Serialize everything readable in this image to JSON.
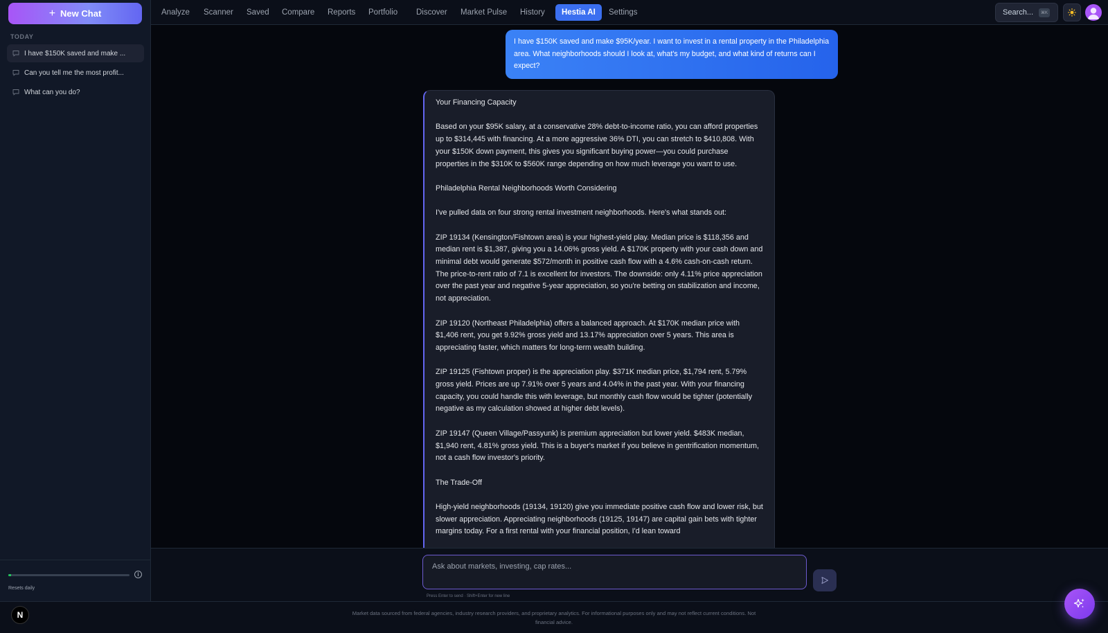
{
  "sidebar": {
    "new_chat_label": "New Chat",
    "section_label": "TODAY",
    "conversations": [
      {
        "title": "I have $150K saved and make ..."
      },
      {
        "title": "Can you tell me the most profit..."
      },
      {
        "title": "What can you do?"
      }
    ],
    "usage_fraction": 0.02,
    "resets_label": "Resets daily"
  },
  "nav": {
    "tabs": [
      "Analyze",
      "Scanner",
      "Saved",
      "Compare",
      "Reports",
      "Portfolio",
      "Discover",
      "Market Pulse",
      "History",
      "Hestia AI",
      "Settings"
    ],
    "active_tab": "Hestia AI",
    "search_label": "Search...",
    "search_shortcut": "⌘K"
  },
  "chat": {
    "user_message": "I have $150K saved and make $95K/year. I want to invest in a rental property in the Philadelphia area. What neighborhoods should I look at, what's my budget, and what kind of returns can I expect?",
    "assistant_paragraphs": [
      "Your Financing Capacity",
      "Based on your $95K salary, at a conservative 28% debt-to-income ratio, you can afford properties up to $314,445 with financing. At a more aggressive 36% DTI, you can stretch to $410,808. With your $150K down payment, this gives you significant buying power—you could purchase properties in the $310K to $560K range depending on how much leverage you want to use.",
      "Philadelphia Rental Neighborhoods Worth Considering",
      "I've pulled data on four strong rental investment neighborhoods. Here's what stands out:",
      "ZIP 19134 (Kensington/Fishtown area) is your highest-yield play. Median price is $118,356 and median rent is $1,387, giving you a 14.06% gross yield. A $170K property with your cash down and minimal debt would generate $572/month in positive cash flow with a 4.6% cash-on-cash return. The price-to-rent ratio of 7.1 is excellent for investors. The downside: only 4.11% price appreciation over the past year and negative 5-year appreciation, so you're betting on stabilization and income, not appreciation.",
      "ZIP 19120 (Northeast Philadelphia) offers a balanced approach. At $170K median price with $1,406 rent, you get 9.92% gross yield and 13.17% appreciation over 5 years. This area is appreciating faster, which matters for long-term wealth building.",
      "ZIP 19125 (Fishtown proper) is the appreciation play. $371K median price, $1,794 rent, 5.79% gross yield. Prices are up 7.91% over 5 years and 4.04% in the past year. With your financing capacity, you could handle this with leverage, but monthly cash flow would be tighter (potentially negative as my calculation showed at higher debt levels).",
      "ZIP 19147 (Queen Village/Passyunk) is premium appreciation but lower yield. $483K median, $1,940 rent, 4.81% gross yield. This is a buyer's market if you believe in gentrification momentum, not a cash flow investor's priority.",
      "The Trade-Off",
      "High-yield neighborhoods (19134, 19120) give you immediate positive cash flow and lower risk, but slower appreciation. Appreciating neighborhoods (19125, 19147) are capital gain bets with tighter margins today. For a first rental with your financial position, I'd lean toward"
    ]
  },
  "composer": {
    "placeholder": "Ask about markets, investing, cap rates...",
    "hint": "Press Enter to send · Shift+Enter for new line"
  },
  "footer": {
    "disclaimer": "Market data sourced from federal agencies, industry research providers, and proprietary analytics. For informational purposes only and may not reflect current conditions. Not financial advice.",
    "logo_letter": "N"
  },
  "colors": {
    "accent": "#3b6ff0",
    "brand_purple": "#a855f7",
    "usage": "#22c55e"
  }
}
